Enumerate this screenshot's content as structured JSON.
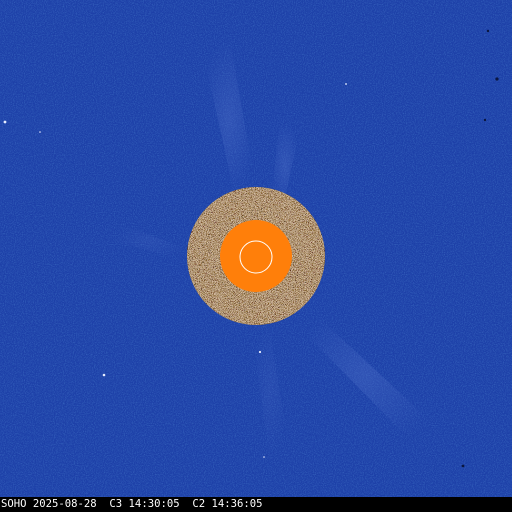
{
  "image": {
    "kind": "coronagraph-composite",
    "caption": "SOHO 2025-08-28  C3 14:30:05  C2 14:36:05"
  },
  "colors": {
    "background_field": "#1b3fa6",
    "caption_bar": "#000000",
    "caption_text": "#ffffff",
    "occulter_disk": "#ff7f0a",
    "inner_ring_noise": "#7a5a3a",
    "sun_outline": "#ffffff"
  }
}
